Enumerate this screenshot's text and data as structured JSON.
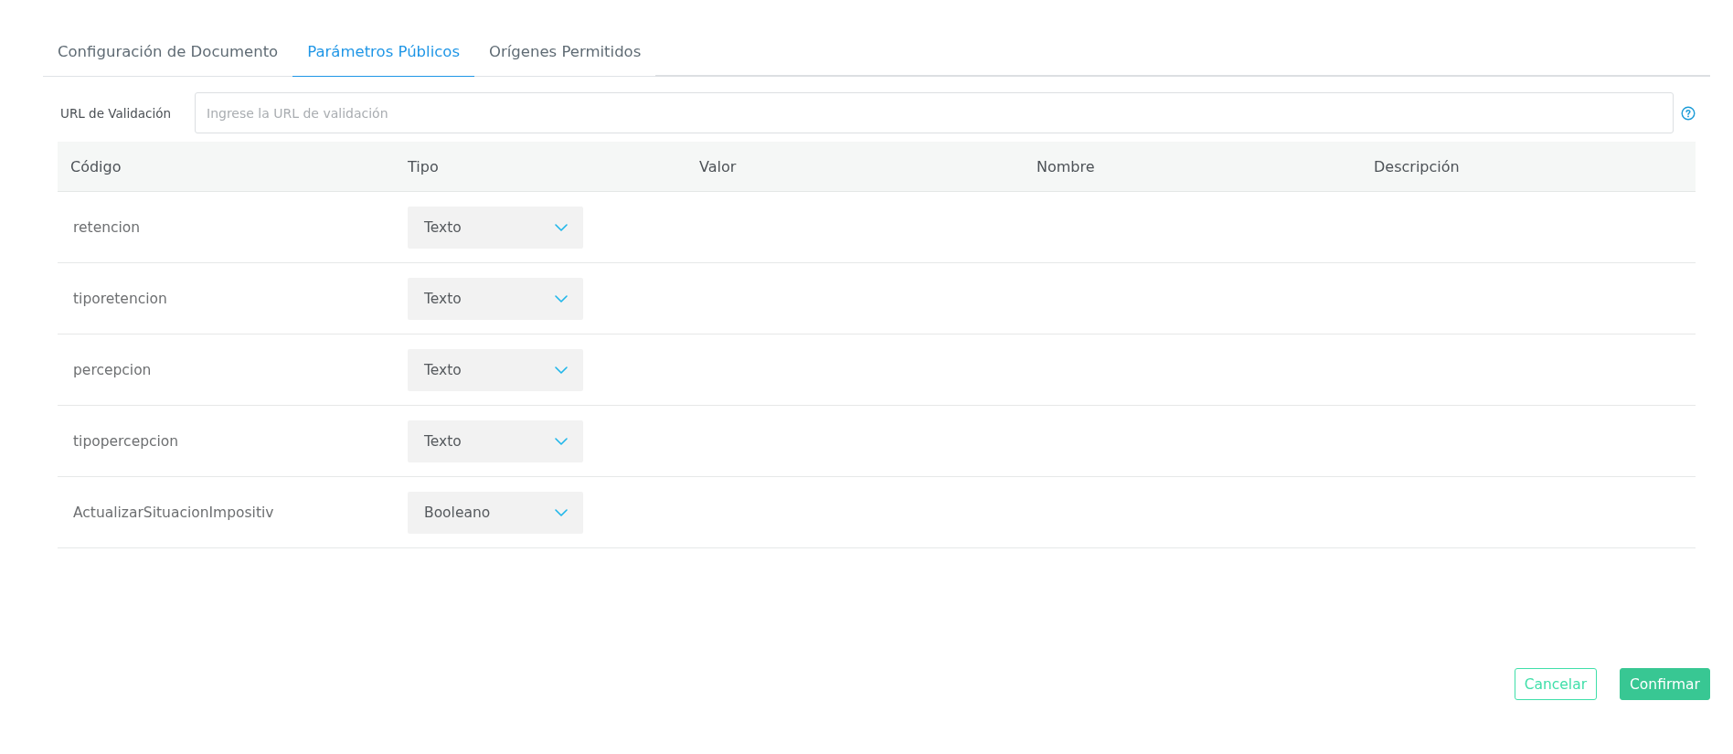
{
  "tabs": [
    {
      "label": "Configuración de Documento",
      "selected": false
    },
    {
      "label": "Parámetros Públicos",
      "selected": true
    },
    {
      "label": "Orígenes Permitidos",
      "selected": false
    }
  ],
  "validation_url": {
    "label": "URL de Validación",
    "placeholder": "Ingrese la URL de validación"
  },
  "table": {
    "columns": [
      "Código",
      "Tipo",
      "Valor",
      "Nombre",
      "Descripción"
    ],
    "rows": [
      {
        "code": "retencion",
        "type": "Texto"
      },
      {
        "code": "tiporetencion",
        "type": "Texto"
      },
      {
        "code": "percepcion",
        "type": "Texto"
      },
      {
        "code": "tipopercepcion",
        "type": "Texto"
      },
      {
        "code": "ActualizarSituacionImpositiv",
        "type": "Booleano"
      }
    ]
  },
  "buttons": [
    {
      "label": "Cancelar",
      "kind": "secondary"
    },
    {
      "label": "Confirmar",
      "kind": "primary"
    }
  ]
}
